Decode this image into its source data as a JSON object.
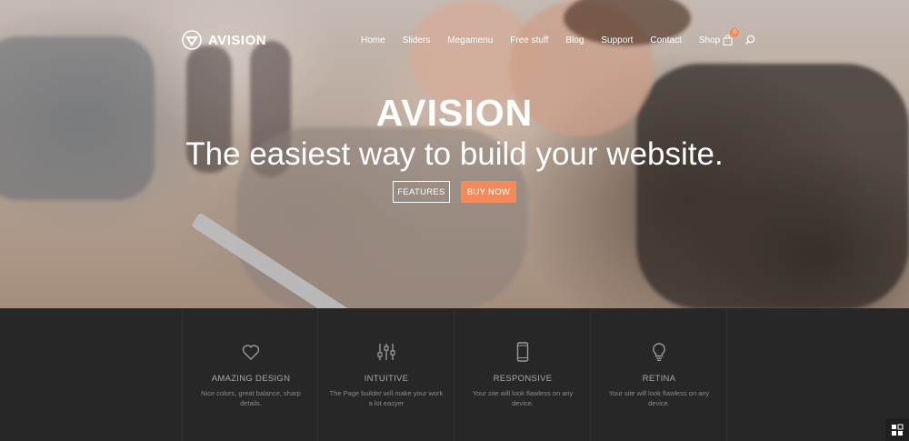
{
  "brand": {
    "name": "AVISION"
  },
  "nav": {
    "items": [
      "Home",
      "Sliders",
      "Megamenu",
      "Free stuff",
      "Blog",
      "Support",
      "Contact"
    ],
    "shop_label": "Shop",
    "cart_count": "0"
  },
  "hero": {
    "title": "AVISION",
    "subtitle": "The easiest way to build your website.",
    "features_button": "FEATURES",
    "buy_button": "BUY NOW"
  },
  "features": [
    {
      "icon": "heart-icon",
      "title": "AMAZING DESIGN",
      "desc": "Nice colors, great balance, sharp details."
    },
    {
      "icon": "sliders-icon",
      "title": "INTUITIVE",
      "desc": "The Page builder will make your work a lot easyer"
    },
    {
      "icon": "mobile-icon",
      "title": "RESPONSIVE",
      "desc": "Your site will look flawless on any device."
    },
    {
      "icon": "lightbulb-icon",
      "title": "RETINA",
      "desc": "Your site will look flawless on any device."
    }
  ],
  "colors": {
    "accent": "#f38a5b",
    "dark_band": "#272727",
    "text_light": "#ffffff"
  }
}
